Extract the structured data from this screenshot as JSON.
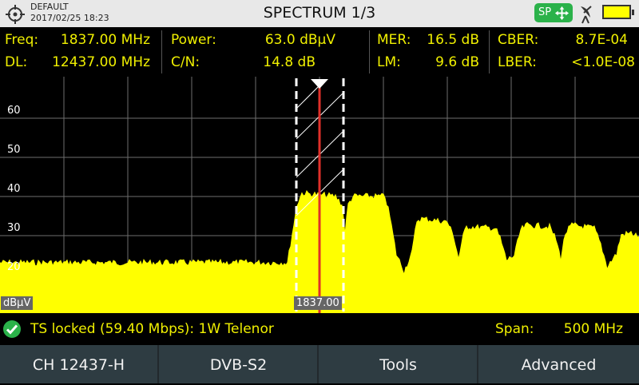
{
  "header": {
    "profile": "DEFAULT",
    "datetime": "2017/02/25 18:23",
    "title": "SPECTRUM 1/3",
    "mode_badge": "SP",
    "icons": [
      "crosshair-icon",
      "move-arrows-icon",
      "satellite-dish-icon",
      "battery-icon"
    ]
  },
  "measurements": {
    "freq_label": "Freq:",
    "freq_value": "1837.00 MHz",
    "dl_label": "DL:",
    "dl_value": "12437.00 MHz",
    "power_label": "Power:",
    "power_value": "63.0 dBµV",
    "cn_label": "C/N:",
    "cn_value": "14.8 dB",
    "mer_label": "MER:",
    "mer_value": "16.5 dB",
    "lm_label": "LM:",
    "lm_value": "9.6 dB",
    "cber_label": "CBER:",
    "cber_value": "8.7E-04",
    "lber_label": "LBER:",
    "lber_value": "<1.0E-08"
  },
  "spectrum": {
    "unit_label": "dBµV",
    "y_ticks": [
      "60",
      "50",
      "40",
      "30",
      "20"
    ],
    "marker_label": "1837.00",
    "colors": {
      "trace": "#ffff00",
      "marker": "#e0302a",
      "grid": "#777777",
      "background": "#000000"
    }
  },
  "status": {
    "message": "TS locked (59.40 Mbps): 1W Telenor",
    "span_label": "Span:",
    "span_value": "500 MHz"
  },
  "softkeys": [
    "CH 12437-H",
    "DVB-S2",
    "Tools",
    "Advanced"
  ],
  "colors": {
    "accent": "#f0f000",
    "softkey_bg": "#2e3c42",
    "badge": "#2bb24a"
  }
}
